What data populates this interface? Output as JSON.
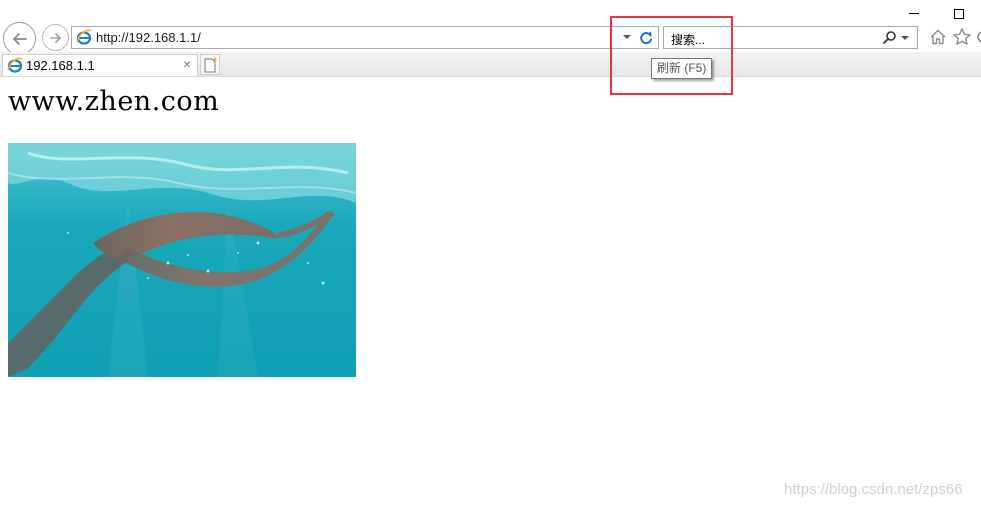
{
  "browser": {
    "address": {
      "url": "http://192.168.1.1/",
      "icon": "ie-logo-icon"
    },
    "search": {
      "placeholder": "搜索...",
      "icon": "search-icon"
    },
    "tab": {
      "title": "192.168.1.1",
      "close_label": "×"
    },
    "tooltip": {
      "text": "刷新 (F5)"
    },
    "icons": [
      "back-arrow-icon",
      "forward-arrow-icon",
      "refresh-icon",
      "home-icon",
      "star-icon",
      "gear-icon",
      "new-tab-icon"
    ],
    "colors": {
      "refresh": "#1a73c8",
      "ie_blue": "#1d7bd7",
      "ie_ring": "#f3b52b",
      "annotation": "#e5383b"
    }
  },
  "page": {
    "heading": "www.zhen.com",
    "image": "underwater-mermaid-fin-photo"
  },
  "watermark": "https://blog.csdn.net/zps66"
}
